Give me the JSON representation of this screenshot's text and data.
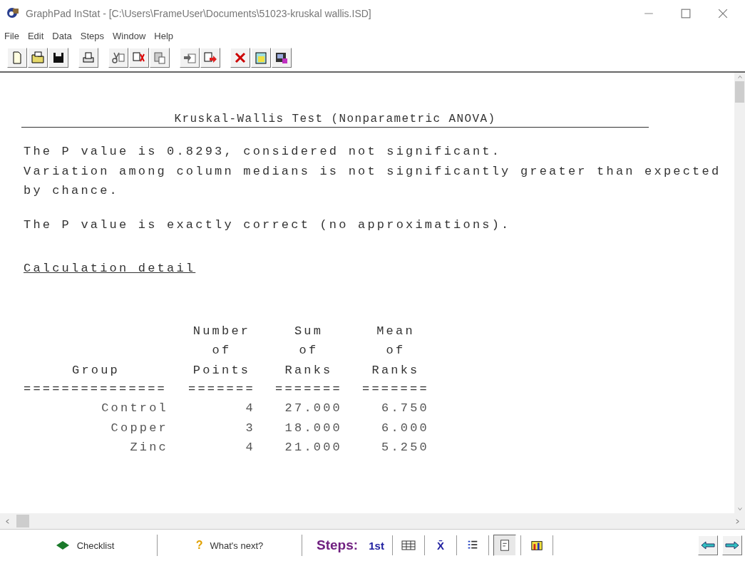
{
  "window": {
    "title": "GraphPad InStat - [C:\\Users\\FrameUser\\Documents\\51023-kruskal wallis.ISD]"
  },
  "menu": [
    "File",
    "Edit",
    "Data",
    "Steps",
    "Window",
    "Help"
  ],
  "toolbar": [
    {
      "buttons": [
        {
          "kind": "new"
        },
        {
          "kind": "open"
        },
        {
          "kind": "save"
        }
      ]
    },
    {
      "buttons": [
        {
          "kind": "print"
        }
      ]
    },
    {
      "buttons": [
        {
          "kind": "cut"
        },
        {
          "kind": "copy"
        },
        {
          "kind": "paste"
        }
      ]
    },
    {
      "buttons": [
        {
          "kind": "import"
        },
        {
          "kind": "export"
        }
      ]
    },
    {
      "buttons": [
        {
          "kind": "delete"
        },
        {
          "kind": "clipboard"
        },
        {
          "kind": "report"
        }
      ]
    }
  ],
  "report": {
    "heading": "Kruskal-Wallis Test (Nonparametric ANOVA)",
    "paragraphs": [
      [
        "The P value is 0.8293, considered not significant.",
        "Variation among column medians is not significantly greater than expected",
        "by chance."
      ],
      [
        "The P value is exactly correct (no approximations)."
      ]
    ],
    "section": "Calculation detail",
    "columns": [
      {
        "lines": [
          "Group"
        ],
        "rule": "==============="
      },
      {
        "lines": [
          "Number",
          "of",
          "Points"
        ],
        "rule": "======="
      },
      {
        "lines": [
          "Sum",
          "of",
          "Ranks"
        ],
        "rule": "======="
      },
      {
        "lines": [
          "Mean",
          "of",
          "Ranks"
        ],
        "rule": "======="
      }
    ],
    "rows": [
      [
        "Control",
        "4",
        "27.000",
        "6.750"
      ],
      [
        "Copper",
        "3",
        "18.000",
        "6.000"
      ],
      [
        "Zinc",
        "4",
        "21.000",
        "5.250"
      ]
    ]
  },
  "bottom_bar": {
    "checklist": "Checklist",
    "whats_next": "What's next?",
    "whats_next_icon": "?",
    "steps_label": "Steps:",
    "steps": [
      {
        "kind": "text",
        "label": "1st",
        "selected": false
      },
      {
        "kind": "table",
        "selected": false
      },
      {
        "kind": "text",
        "label": "X̄",
        "selected": false
      },
      {
        "kind": "list",
        "selected": false
      },
      {
        "kind": "report",
        "selected": true
      },
      {
        "kind": "chart",
        "selected": false
      }
    ]
  }
}
